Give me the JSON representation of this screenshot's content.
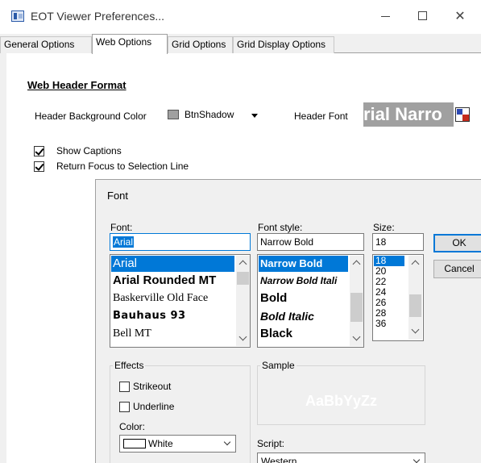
{
  "window": {
    "title": "EOT Viewer Preferences...",
    "close_glyph": "✕"
  },
  "tabs": [
    {
      "label": "General Options"
    },
    {
      "label": "Web Options",
      "active": true
    },
    {
      "label": "Grid Options"
    },
    {
      "label": "Grid Display Options"
    }
  ],
  "web_options": {
    "section_title": "Web Header Format",
    "bg_color_label": "Header Background Color",
    "bg_color_value": "BtnShadow",
    "bg_swatch_color": "#a0a0a0",
    "header_font_label": "Header Font",
    "header_font_preview": "rial Narro",
    "show_captions": {
      "label": "Show Captions",
      "checked": true
    },
    "return_focus": {
      "label": "Return Focus to Selection Line",
      "checked": true
    }
  },
  "font_dialog": {
    "title": "Font",
    "font_label": "Font:",
    "font_value": "Arial",
    "font_list": [
      "Arial",
      "Arial Rounded MT",
      "Baskerville Old Face",
      "Bauhaus 93",
      "Bell MT"
    ],
    "style_label": "Font style:",
    "style_value": "Narrow Bold",
    "style_list": [
      "Narrow Bold",
      "Narrow Bold Itali",
      "Bold",
      "Bold Italic",
      "Black"
    ],
    "size_label": "Size:",
    "size_value": "18",
    "size_list": [
      "18",
      "20",
      "22",
      "24",
      "26",
      "28",
      "36"
    ],
    "ok_label": "OK",
    "cancel_label": "Cancel",
    "effects_label": "Effects",
    "strikeout_label": "Strikeout",
    "underline_label": "Underline",
    "color_label": "Color:",
    "color_value": "White",
    "color_swatch": "#ffffff",
    "sample_label": "Sample",
    "sample_text": "AaBbYyZz",
    "script_label": "Script:",
    "script_value": "Western"
  }
}
